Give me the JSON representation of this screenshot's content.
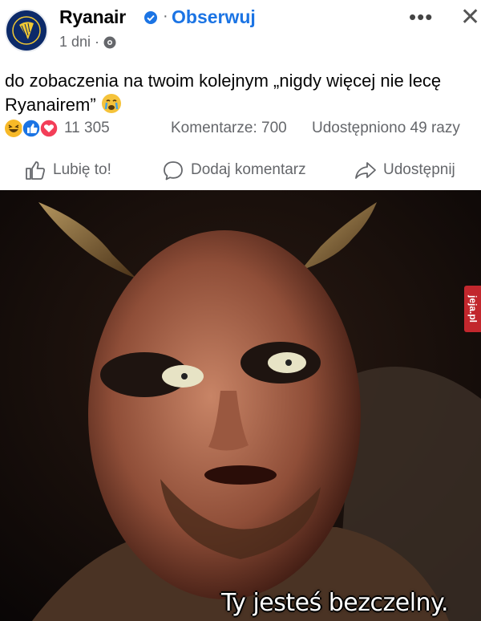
{
  "post": {
    "page_name": "Ryanair",
    "follow_label": "Obserwuj",
    "separator": "·",
    "time": "1 dni ·",
    "more_label": "•••",
    "close_label": "✕",
    "caption": "do zobaczenia na twoim kolejnym „nigdy więcej nie lecę Ryanairem”"
  },
  "stats": {
    "reactions_count": "11 305",
    "comments": "Komentarze: 700",
    "shares": "Udostępniono 49 razy"
  },
  "actions": {
    "like": "Lubię to!",
    "comment": "Dodaj komentarz",
    "share": "Udostępnij"
  },
  "meme": {
    "subtitle": "Ty jesteś bezczelny.",
    "watermark": "jeja.pl"
  },
  "colors": {
    "follow_blue": "#1b74e4",
    "meta_gray": "#65676b",
    "avatar_navy": "#0c2a69",
    "avatar_gold": "#f1c933",
    "watermark_red": "#c2272d"
  },
  "icons": {
    "verified": "verified-badge-icon",
    "privacy": "globe-icon",
    "like": "thumbs-up-icon",
    "comment": "comment-bubble-icon",
    "share": "share-arrow-icon"
  }
}
